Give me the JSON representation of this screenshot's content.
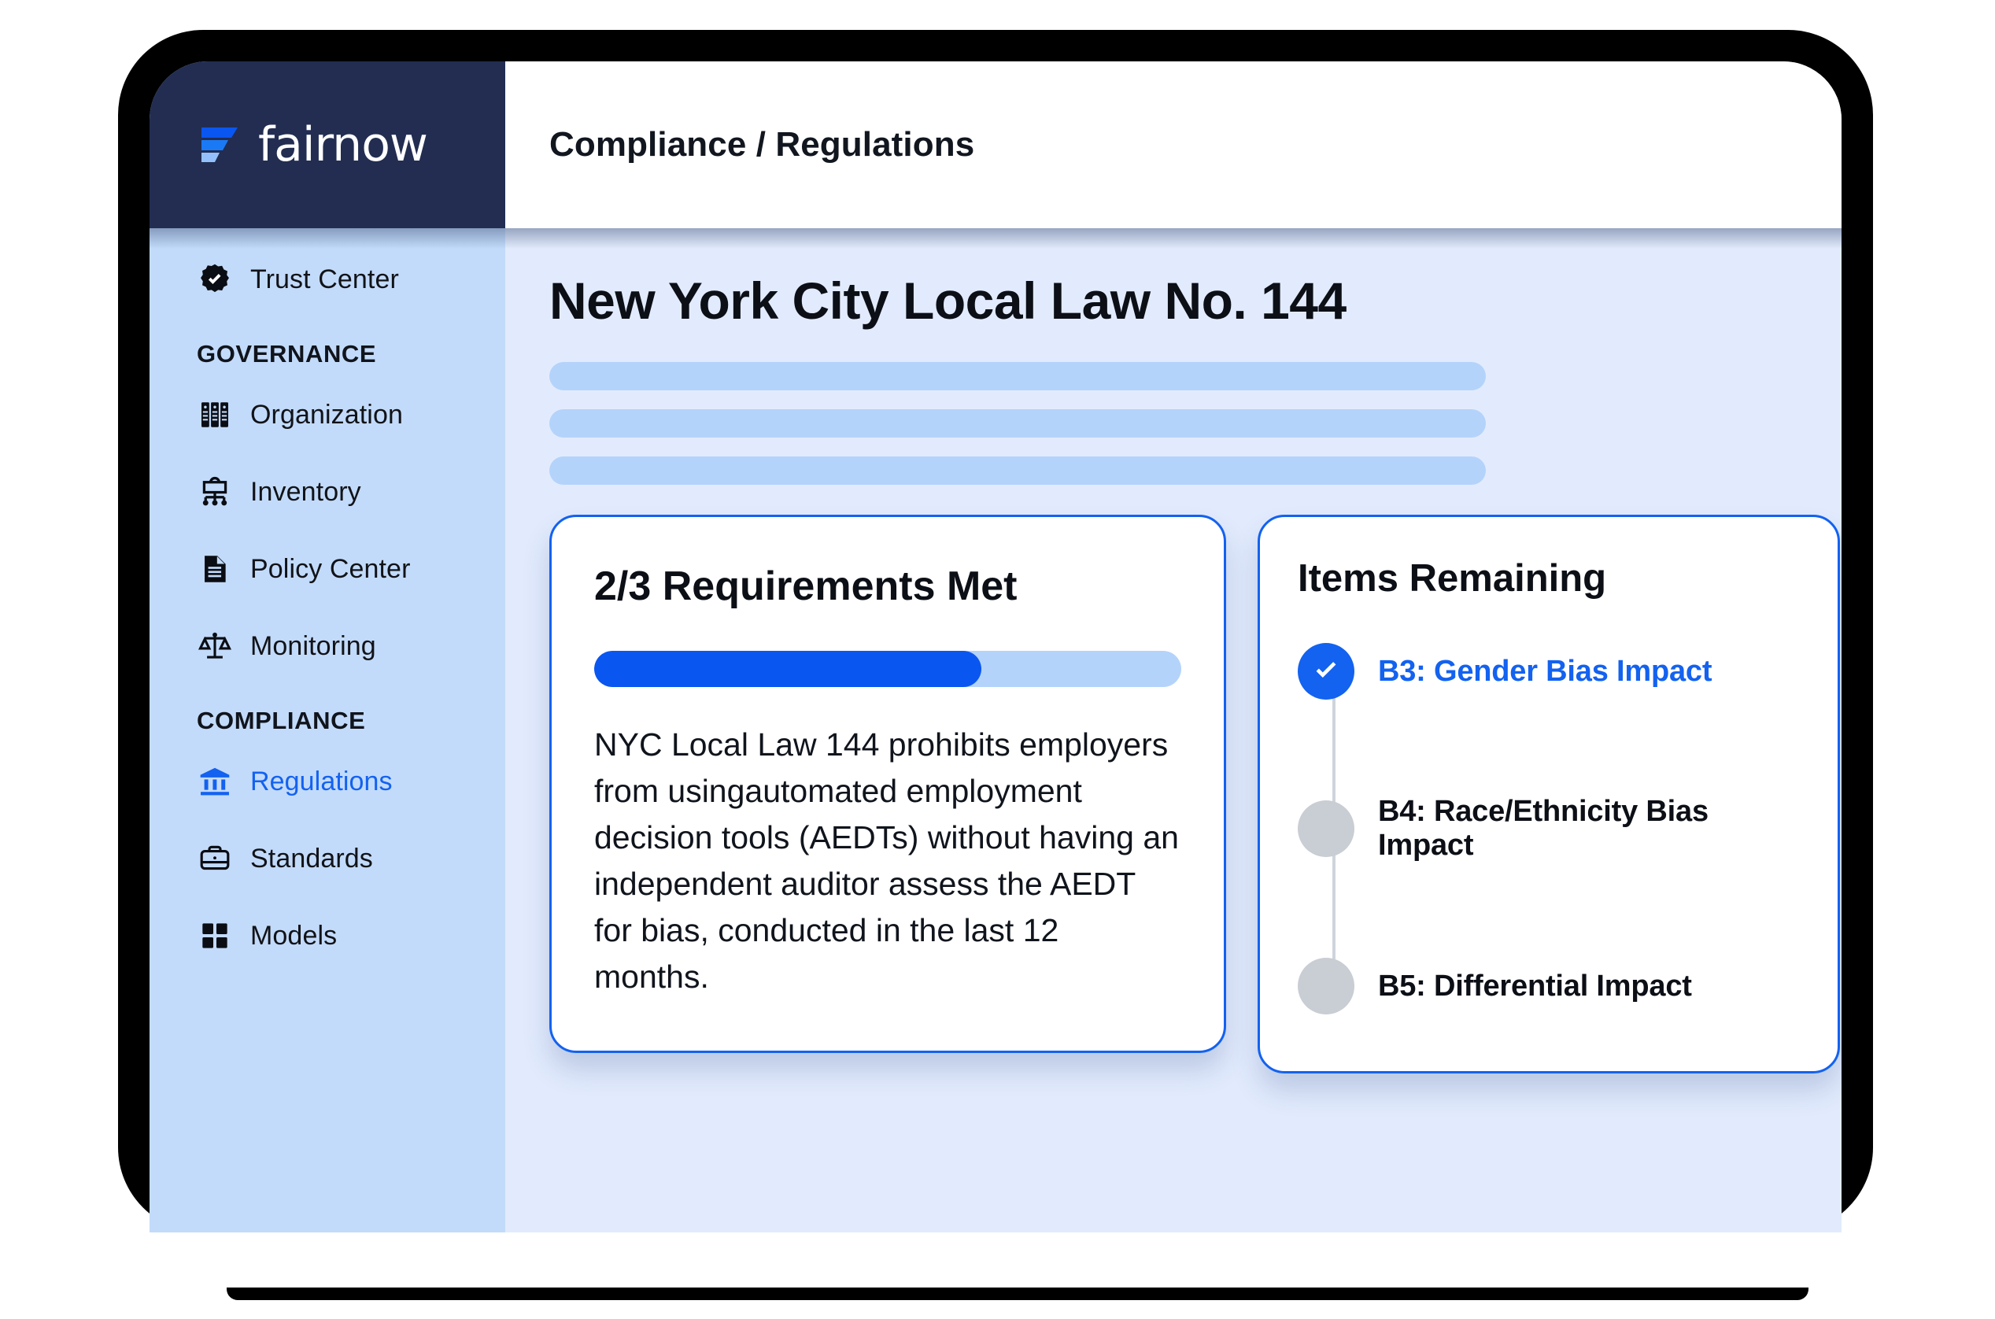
{
  "brand": {
    "name": "fairnow",
    "logo_icon": "fairnow-logo-mark",
    "navy": "#222d51",
    "accent": "#1362f0"
  },
  "header": {
    "breadcrumb": "Compliance / Regulations"
  },
  "sidebar": {
    "top_items": [
      {
        "label": "Trust Center",
        "icon": "verified-badge-icon",
        "active": false
      }
    ],
    "sections": [
      {
        "label": "GOVERNANCE",
        "items": [
          {
            "label": "Organization",
            "icon": "file-cabinet-icon",
            "active": false
          },
          {
            "label": "Inventory",
            "icon": "hierarchy-icon",
            "active": false
          },
          {
            "label": "Policy Center",
            "icon": "document-icon",
            "active": false
          },
          {
            "label": "Monitoring",
            "icon": "scales-icon",
            "active": false
          }
        ]
      },
      {
        "label": "COMPLIANCE",
        "items": [
          {
            "label": "Regulations",
            "icon": "bank-icon",
            "active": true
          },
          {
            "label": "Standards",
            "icon": "briefcase-icon",
            "active": false
          },
          {
            "label": "Models",
            "icon": "grid-icon",
            "active": false
          }
        ]
      }
    ]
  },
  "main": {
    "page_title": "New York City Local Law No. 144",
    "skeleton_line_count": 3,
    "requirements_card": {
      "title": "2/3 Requirements Met",
      "progress_percent": 66,
      "description": "NYC Local Law 144 prohibits employers from usingautomated employment decision tools (AEDTs) without having an independent auditor assess the AEDT for bias, conducted in the last 12 months."
    },
    "items_card": {
      "title": "Items Remaining",
      "steps": [
        {
          "label": "B3: Gender Bias Impact",
          "state": "done",
          "icon": "check-icon"
        },
        {
          "label": "B4: Race/Ethnicity Bias Impact",
          "state": "pending",
          "icon": "empty-dot-icon"
        },
        {
          "label": "B5: Differential Impact",
          "state": "pending",
          "icon": "empty-dot-icon"
        }
      ]
    }
  }
}
